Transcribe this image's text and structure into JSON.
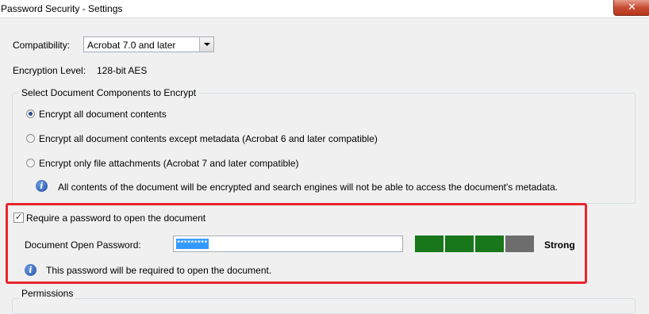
{
  "window": {
    "title": "Password Security - Settings",
    "close_glyph": "✕"
  },
  "compatibility": {
    "label": "Compatibility:",
    "selected": "Acrobat 7.0 and later"
  },
  "encryption": {
    "label": "Encryption  Level:",
    "value": "128-bit AES"
  },
  "components": {
    "title": "Select Document Components to Encrypt",
    "options": [
      {
        "label": "Encrypt all document contents",
        "checked": true
      },
      {
        "label": "Encrypt all document contents except metadata (Acrobat 6 and later compatible)",
        "checked": false
      },
      {
        "label": "Encrypt only file attachments (Acrobat 7 and later compatible)",
        "checked": false
      }
    ],
    "info_text": "All contents of the document will be encrypted and search engines will not be able to access the document's metadata.",
    "info_icon": "info-icon"
  },
  "open_password": {
    "require_label": "Require a password to open the document",
    "require_checked": true,
    "field_label": "Document Open Password:",
    "field_value": "*********",
    "strength_label": "Strong",
    "strength_level": 0.75,
    "strength_colors": {
      "filled": "#17771a",
      "empty": "#6d6d6d"
    },
    "info_text": "This password will be required to open the document."
  },
  "permissions": {
    "title": "Permissions"
  },
  "highlight_color": "#e8262d"
}
